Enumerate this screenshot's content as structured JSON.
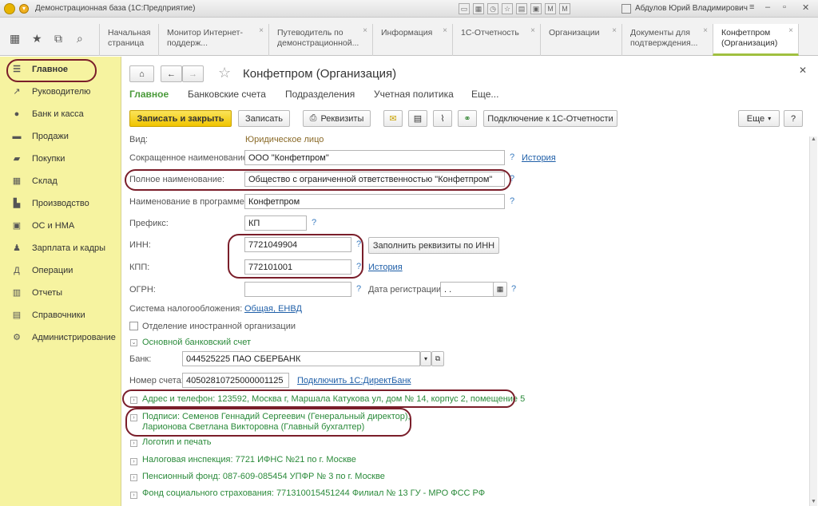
{
  "titlebar": {
    "title": "Демонстрационная база  (1С:Предприятие)",
    "user": "Абдулов Юрий Владимирович"
  },
  "tabs": [
    {
      "label": "Начальная страница"
    },
    {
      "label": "Монитор Интернет-поддерж..."
    },
    {
      "label": "Путеводитель по демонстрационной..."
    },
    {
      "label": "Информация"
    },
    {
      "label": "1С-Отчетность"
    },
    {
      "label": "Организации"
    },
    {
      "label": "Документы для подтверждения..."
    },
    {
      "label": "Конфетпром (Организация)"
    }
  ],
  "sidebar": {
    "items": [
      {
        "label": "Главное",
        "icon": "menu-icon"
      },
      {
        "label": "Руководителю",
        "icon": "chart-icon"
      },
      {
        "label": "Банк и касса",
        "icon": "money-icon"
      },
      {
        "label": "Продажи",
        "icon": "cart-icon"
      },
      {
        "label": "Покупки",
        "icon": "basket-icon"
      },
      {
        "label": "Склад",
        "icon": "warehouse-icon"
      },
      {
        "label": "Производство",
        "icon": "factory-icon"
      },
      {
        "label": "ОС и НМА",
        "icon": "assets-icon"
      },
      {
        "label": "Зарплата и кадры",
        "icon": "people-icon"
      },
      {
        "label": "Операции",
        "icon": "operations-icon"
      },
      {
        "label": "Отчеты",
        "icon": "reports-icon"
      },
      {
        "label": "Справочники",
        "icon": "book-icon"
      },
      {
        "label": "Администрирование",
        "icon": "gear-icon"
      }
    ]
  },
  "form": {
    "title": "Конфетпром (Организация)",
    "subnav": [
      "Главное",
      "Банковские счета",
      "Подразделения",
      "Учетная политика",
      "Еще..."
    ],
    "buttons": {
      "save_close": "Записать и закрыть",
      "save": "Записать",
      "requisites": "Реквизиты",
      "connect": "Подключение к 1С-Отчетности",
      "more": "Еще",
      "help": "?",
      "fill_inn": "Заполнить реквизиты по ИНН"
    },
    "fields": {
      "vid_label": "Вид:",
      "vid_value": "Юридическое лицо",
      "short_label": "Сокращенное наименование:",
      "short_value": "ООО \"Конфетпром\"",
      "full_label": "Полное наименование:",
      "full_value": "Общество с ограниченной ответственностью \"Конфетпром\"",
      "program_label": "Наименование в программе:",
      "program_value": "Конфетпром",
      "prefix_label": "Префикс:",
      "prefix_value": "КП",
      "inn_label": "ИНН:",
      "inn_value": "7721049904",
      "kpp_label": "КПП:",
      "kpp_value": "772101001",
      "ogrn_label": "ОГРН:",
      "ogrn_value": "",
      "reg_date_label": "Дата регистрации:",
      "reg_date_value": " .  . ",
      "tax_label": "Система налогообложения:",
      "tax_value": "Общая, ЕНВД",
      "foreign_label": "Отделение иностранной организации",
      "history": "История",
      "question": "?"
    },
    "bank": {
      "section": "Основной банковский счет",
      "bank_label": "Банк:",
      "bank_value": "044525225 ПАО СБЕРБАНК",
      "account_label": "Номер счета:",
      "account_value": "40502810725000001125",
      "direct_link": "Подключить 1С:ДиректБанк"
    },
    "sections": {
      "address": "Адрес и телефон: 123592, Москва г, Маршала Катукова ул, дом № 14, корпус 2, помещение 5",
      "signatures_1": "Подписи: Семенов Геннадий Сергеевич (Генеральный директор),",
      "signatures_2": "Ларионова Светлана Викторовна (Главный бухгалтер)",
      "logo": "Логотип и печать",
      "tax_office": "Налоговая инспекция: 7721 ИФНС №21 по г. Москве",
      "pension": "Пенсионный фонд: 087-609-085454 УПФР № 3 по г. Москве",
      "social": "Фонд социального страхования: 771310015451244 Филиал № 13 ГУ - МРО ФСС РФ"
    }
  }
}
